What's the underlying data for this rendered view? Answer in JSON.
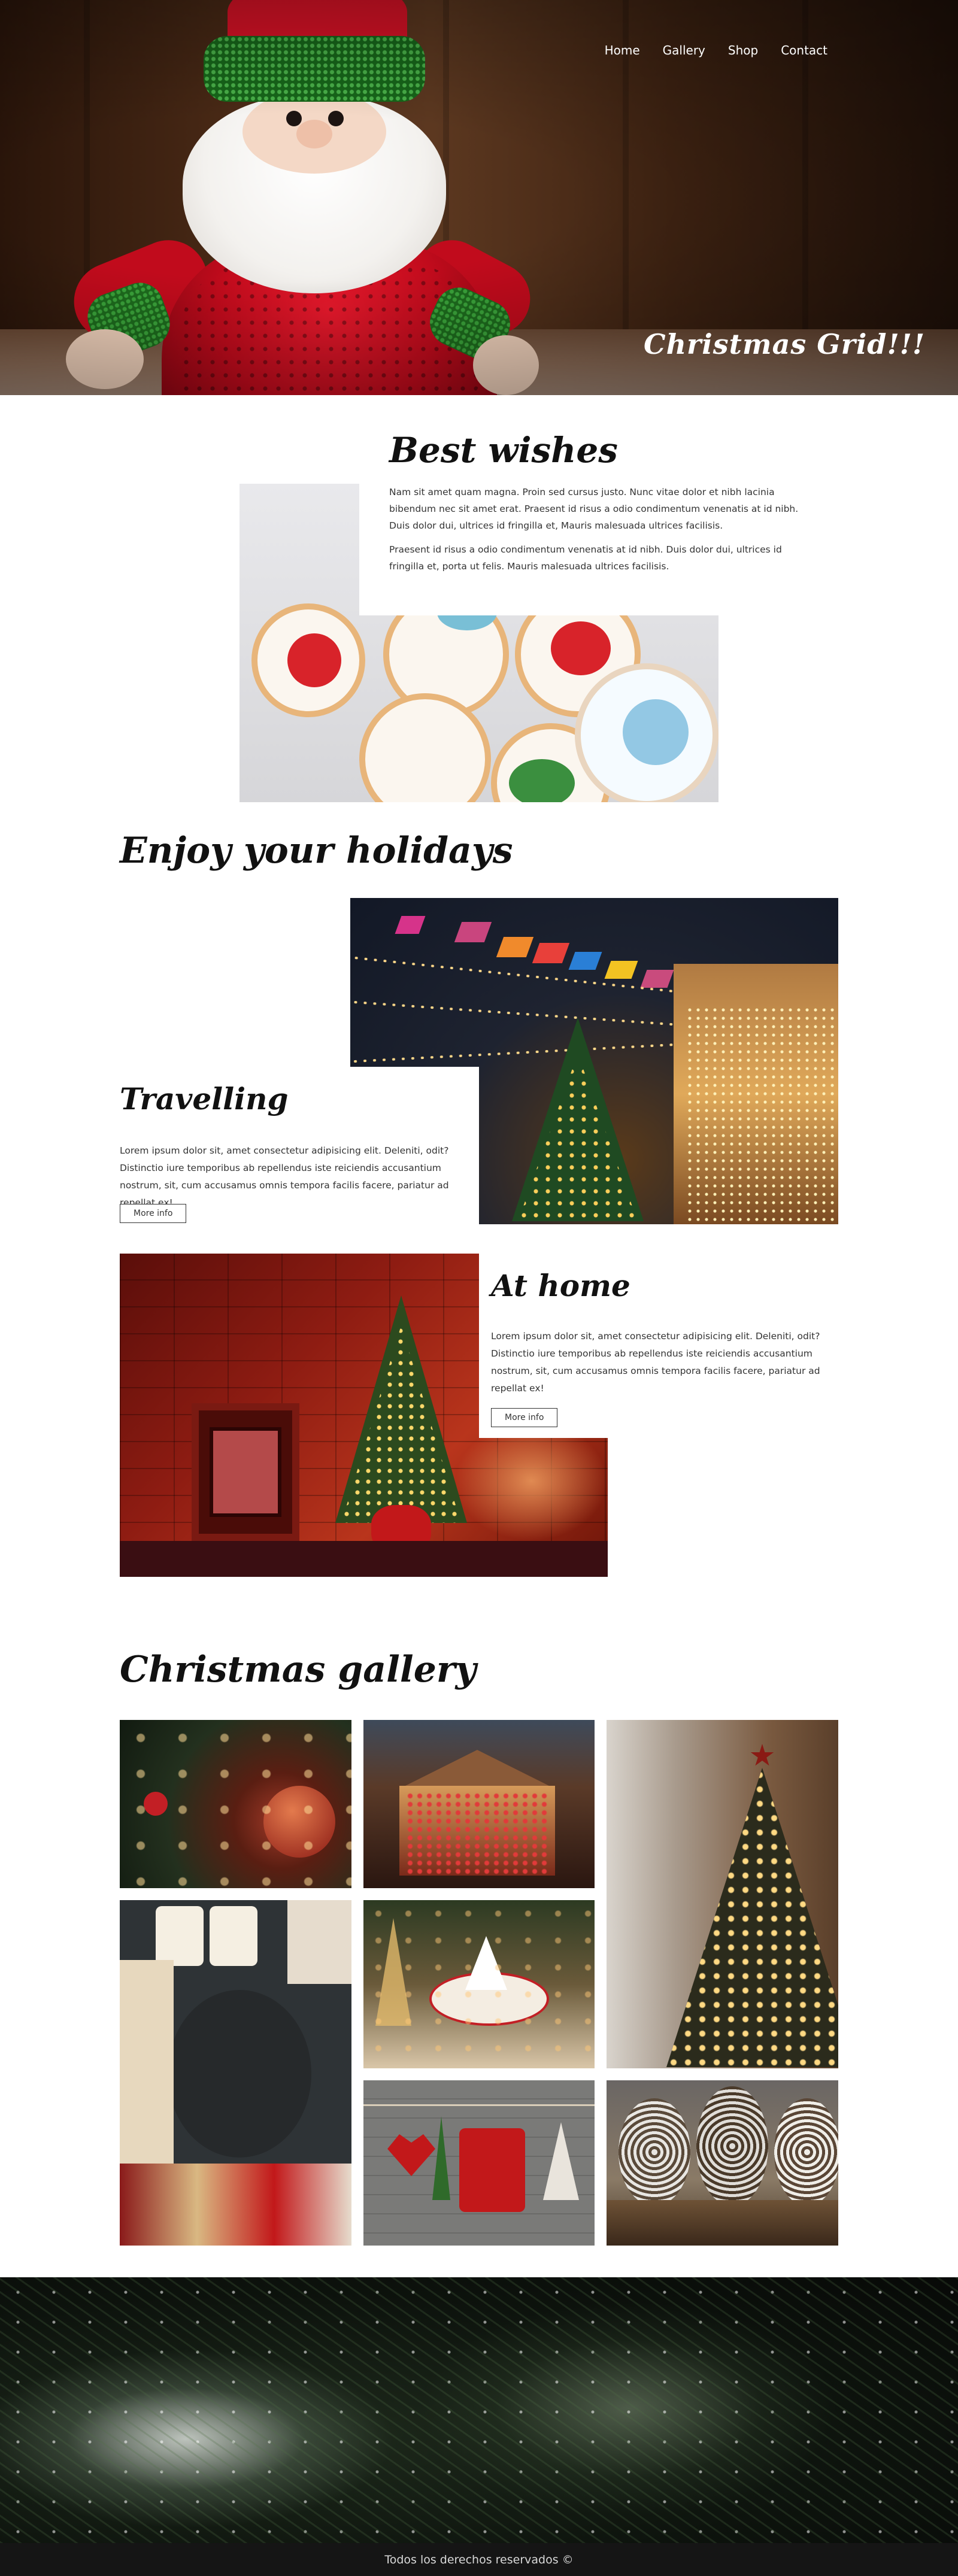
{
  "nav": {
    "home": "Home",
    "gallery": "Gallery",
    "shop": "Shop",
    "contact": "Contact"
  },
  "hero": {
    "title": "Christmas Grid!!!"
  },
  "best_wishes": {
    "title": "Best wishes",
    "paragraph1": "Nam sit amet quam magna. Proin sed cursus justo. Nunc vitae dolor et nibh lacinia bibendum nec sit amet erat. Praesent id risus a odio condimentum venenatis at id nibh. Duis dolor dui, ultrices id fringilla et, Mauris malesuada ultrices facilisis.",
    "paragraph2": "Praesent id risus a odio condimentum venenatis at id nibh. Duis dolor dui, ultrices id fringilla et, porta ut felis. Mauris malesuada ultrices facilisis."
  },
  "enjoy": {
    "title": "Enjoy your holidays",
    "travelling": {
      "title": "Travelling",
      "text": "Lorem ipsum dolor sit, amet consectetur adipisicing elit. Deleniti, odit? Distinctio iure temporibus ab repellendus iste reiciendis accusantium nostrum, sit, cum accusamus omnis tempora facilis facere, pariatur ad repellat ex!",
      "button": "More info"
    },
    "at_home": {
      "title": "At home",
      "text": "Lorem ipsum dolor sit, amet consectetur adipisicing elit. Deleniti, odit? Distinctio iure temporibus ab repellendus iste reiciendis accusantium nostrum, sit, cum accusamus omnis tempora facilis facere, pariatur ad repellat ex!",
      "button": "More info"
    }
  },
  "gallery": {
    "title": "Christmas gallery",
    "images": [
      "ornament-tree-photo",
      "christmas-market-stall-photo",
      "lit-christmas-tree-photo",
      "gifts-and-candles-photo",
      "table-setting-photo",
      "felt-ornaments-photo",
      "pine-cones-photo"
    ]
  },
  "footer": {
    "text": "Todos los derechos reservados ©"
  },
  "colors": {
    "footer_bg": "#151515",
    "text": "#222222",
    "hero_text": "#ffffff"
  }
}
